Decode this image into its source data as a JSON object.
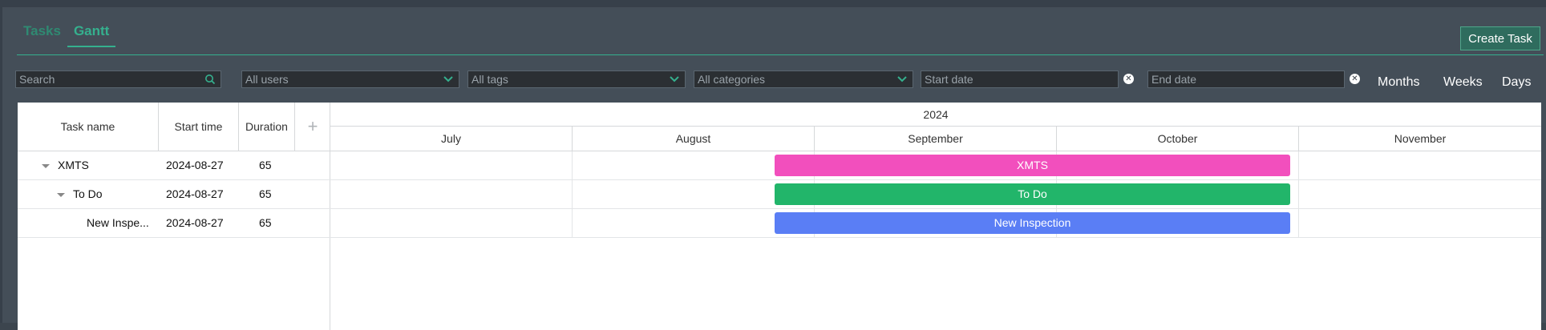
{
  "tabs": [
    {
      "label": "Tasks",
      "active": false
    },
    {
      "label": "Gantt",
      "active": true
    }
  ],
  "create_button": "Create Task",
  "filters": {
    "search_placeholder": "Search",
    "users": "All users",
    "tags": "All tags",
    "categories": "All categories",
    "start_date_placeholder": "Start date",
    "end_date_placeholder": "End date"
  },
  "scale_buttons": [
    "Months",
    "Weeks",
    "Days"
  ],
  "grid": {
    "columns": [
      "Task name",
      "Start time",
      "Duration"
    ],
    "add_symbol": "+",
    "rows": [
      {
        "name": "XMTS",
        "start": "2024-08-27",
        "duration": "65",
        "level": 0,
        "expandable": true
      },
      {
        "name": "To Do",
        "start": "2024-08-27",
        "duration": "65",
        "level": 1,
        "expandable": true
      },
      {
        "name": "New Inspe...",
        "start": "2024-08-27",
        "duration": "65",
        "level": 2,
        "expandable": false
      }
    ]
  },
  "timeline": {
    "year": "2024",
    "months": [
      "July",
      "August",
      "September",
      "October",
      "November"
    ]
  },
  "bars": [
    {
      "label": "XMTS",
      "color": "#f24fbd"
    },
    {
      "label": "To Do",
      "color": "#22b56a"
    },
    {
      "label": "New Inspection",
      "color": "#5a7ef5"
    }
  ],
  "colors": {
    "accent": "#35b08e",
    "background": "#444e58"
  }
}
